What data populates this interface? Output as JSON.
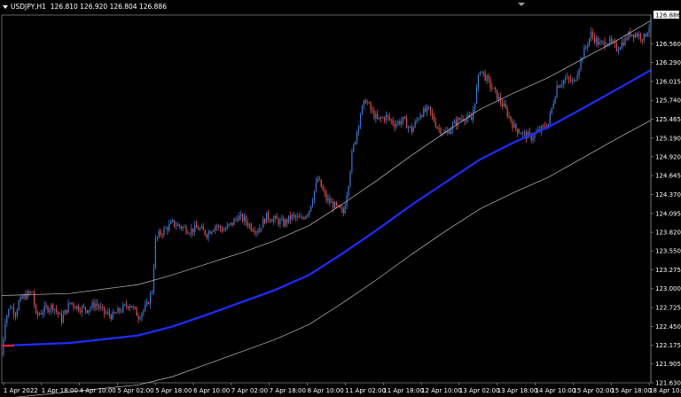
{
  "header": {
    "symbol": "USDJPY,H1",
    "ohlc": "126.810 126.920 126.804 126.886"
  },
  "current_price": "126.886",
  "colors": {
    "background": "#000000",
    "bull": "#3a7bd5",
    "bear": "#d9534f",
    "ma": "#1f2cff",
    "envelope": "#bfbfbf",
    "axis": "#ffffff",
    "marker": "#ff2020"
  },
  "chart_data": {
    "type": "line",
    "title": "",
    "xlabel": "",
    "ylabel": "",
    "grid": false,
    "ylim": [
      121.63,
      126.98
    ],
    "y_ticks": [
      "126.560",
      "126.290",
      "126.015",
      "125.740",
      "125.465",
      "125.190",
      "124.920",
      "124.645",
      "124.370",
      "124.095",
      "123.820",
      "123.550",
      "123.275",
      "123.000",
      "122.725",
      "122.450",
      "122.175",
      "121.905",
      "121.630"
    ],
    "x_ticks": [
      "1 Apr 2022",
      "1 Apr 18:00",
      "4 Apr 10:00",
      "5 Apr 02:00",
      "5 Apr 18:00",
      "6 Apr 10:00",
      "7 Apr 02:00",
      "7 Apr 18:00",
      "8 Apr 10:00",
      "11 Apr 02:00",
      "11 Apr 18:00",
      "12 Apr 10:00",
      "13 Apr 02:00",
      "13 Apr 18:00",
      "14 Apr 10:00",
      "15 Apr 02:00",
      "15 Apr 18:00",
      "18 Apr 10:00"
    ],
    "price_close_path": {
      "x_index": [
        0,
        2,
        5,
        8,
        10,
        14,
        18,
        20,
        25,
        30,
        35,
        40,
        45,
        50,
        55,
        60,
        65,
        70,
        75,
        80,
        85,
        88,
        90,
        92,
        95,
        100,
        105,
        110,
        115,
        120,
        125,
        130,
        135,
        138,
        142,
        146,
        150,
        155,
        160,
        165,
        170,
        175,
        180,
        185,
        190,
        195,
        200,
        203,
        205,
        208,
        210,
        213,
        216,
        220,
        225,
        230,
        235,
        240,
        245,
        250,
        255,
        260,
        265,
        270,
        275,
        280,
        285,
        290,
        295,
        300,
        305,
        310,
        315,
        320,
        325,
        330,
        335,
        340,
        345,
        350,
        355,
        360,
        365,
        368,
        372,
        376,
        380
      ],
      "close": [
        122.05,
        122.55,
        122.75,
        122.65,
        122.8,
        122.9,
        122.95,
        122.6,
        122.7,
        122.75,
        122.55,
        122.8,
        122.72,
        122.7,
        122.78,
        122.65,
        122.6,
        122.7,
        122.78,
        122.6,
        122.75,
        122.98,
        123.7,
        123.78,
        123.85,
        123.95,
        123.9,
        123.85,
        123.88,
        123.8,
        123.92,
        123.85,
        123.95,
        124.05,
        124.0,
        123.9,
        123.85,
        124.05,
        124.0,
        123.95,
        124.05,
        124.0,
        124.15,
        124.6,
        124.3,
        124.2,
        124.1,
        124.55,
        124.95,
        125.3,
        125.55,
        125.75,
        125.6,
        125.45,
        125.5,
        125.4,
        125.45,
        125.3,
        125.55,
        125.6,
        125.35,
        125.25,
        125.4,
        125.5,
        125.45,
        126.2,
        126.0,
        125.8,
        125.6,
        125.35,
        125.25,
        125.2,
        125.3,
        125.4,
        125.95,
        126.05,
        126.0,
        126.4,
        126.7,
        126.55,
        126.6,
        126.5,
        126.62,
        126.72,
        126.7,
        126.65,
        126.88
      ]
    },
    "series": [
      {
        "role": "moving-average",
        "x_index": [
          0,
          40,
          80,
          100,
          120,
          140,
          160,
          180,
          200,
          220,
          240,
          260,
          280,
          300,
          320,
          340,
          360,
          380
        ],
        "values": [
          122.17,
          122.21,
          122.32,
          122.45,
          122.62,
          122.8,
          122.98,
          123.2,
          123.52,
          123.86,
          124.22,
          124.55,
          124.88,
          125.13,
          125.35,
          125.62,
          125.9,
          126.18
        ]
      },
      {
        "role": "upper-band",
        "x_index": [
          0,
          40,
          80,
          100,
          120,
          140,
          160,
          180,
          200,
          220,
          240,
          260,
          280,
          300,
          320,
          340,
          360,
          380
        ],
        "values": [
          122.9,
          122.93,
          123.06,
          123.2,
          123.36,
          123.52,
          123.7,
          123.92,
          124.24,
          124.58,
          124.94,
          125.28,
          125.61,
          125.85,
          126.07,
          126.34,
          126.61,
          126.9
        ]
      },
      {
        "role": "lower-band",
        "x_index": [
          0,
          40,
          80,
          100,
          120,
          140,
          160,
          180,
          200,
          220,
          240,
          260,
          280,
          300,
          320,
          340,
          360,
          380
        ],
        "values": [
          121.4,
          121.5,
          121.6,
          121.72,
          121.9,
          122.08,
          122.26,
          122.48,
          122.8,
          123.14,
          123.5,
          123.84,
          124.16,
          124.4,
          124.62,
          124.9,
          125.18,
          125.45
        ]
      }
    ]
  }
}
